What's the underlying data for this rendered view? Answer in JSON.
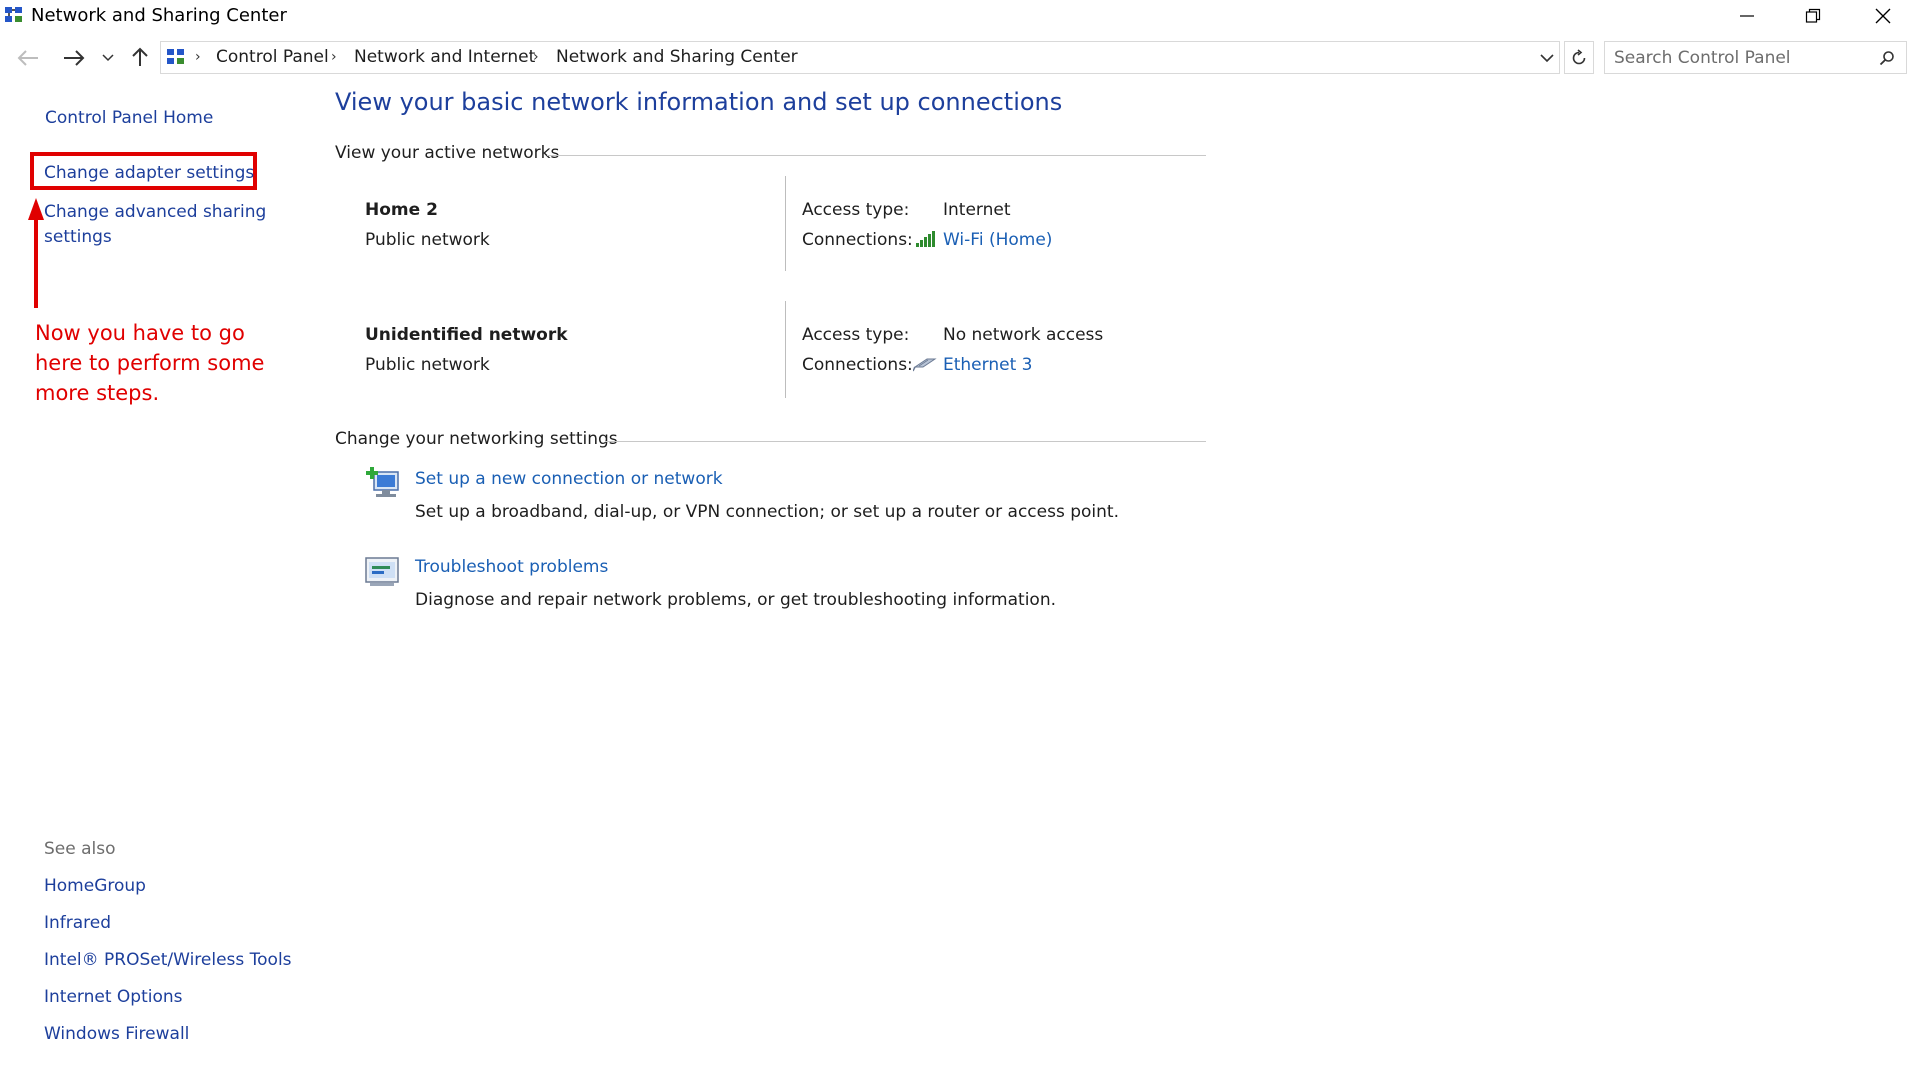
{
  "window": {
    "title": "Network and Sharing Center",
    "minimize_icon": "minimize-icon",
    "restore_icon": "restore-icon",
    "close_icon": "close-icon"
  },
  "address_bar": {
    "breadcrumbs": [
      "Control Panel",
      "Network and Internet",
      "Network and Sharing Center"
    ],
    "search_placeholder": "Search Control Panel"
  },
  "sidebar": {
    "home": "Control Panel Home",
    "change_adapter": "Change adapter settings",
    "change_advanced_line1": "Change advanced sharing",
    "change_advanced_line2": "settings",
    "see_also_title": "See also",
    "see_also": [
      "HomeGroup",
      "Infrared",
      "Intel® PROSet/Wireless Tools",
      "Internet Options",
      "Windows Firewall"
    ]
  },
  "annotation": {
    "text": "Now you have to go here to perform some more steps.",
    "color": "#e00000"
  },
  "main": {
    "heading": "View your basic network information and set up connections",
    "active_networks_title": "View your active networks",
    "networks": [
      {
        "name": "Home  2",
        "type": "Public network",
        "access_label": "Access type:",
        "access_value": "Internet",
        "connections_label": "Connections:",
        "connection": "Wi-Fi (Home)",
        "connection_icon": "wifi-signal-icon"
      },
      {
        "name": "Unidentified network",
        "type": "Public network",
        "access_label": "Access type:",
        "access_value": "No network access",
        "connections_label": "Connections:",
        "connection": "Ethernet 3",
        "connection_icon": "ethernet-icon"
      }
    ],
    "settings_title": "Change your networking settings",
    "settings": [
      {
        "link": "Set up a new connection or network",
        "description": "Set up a broadband, dial-up, or VPN connection; or set up a router or access point.",
        "icon": "new-connection-icon"
      },
      {
        "link": "Troubleshoot problems",
        "description": "Diagnose and repair network problems, or get troubleshooting information.",
        "icon": "troubleshoot-icon"
      }
    ]
  },
  "colors": {
    "link": "#1a5fb4",
    "heading": "#1d3f9c",
    "annotation": "#e00000"
  }
}
